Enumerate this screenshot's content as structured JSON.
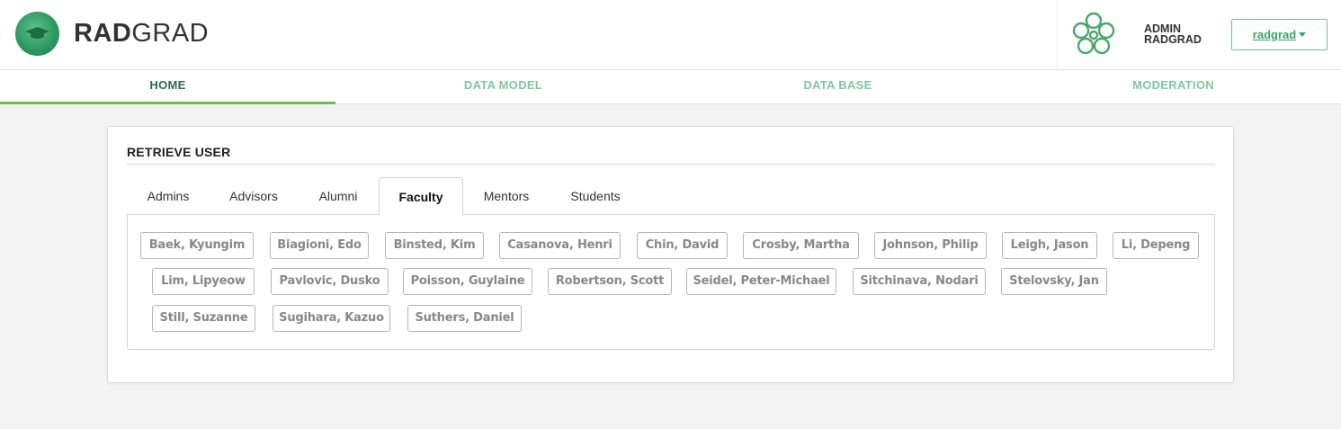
{
  "header": {
    "brand_bold": "RAD",
    "brand_light": "GRAD",
    "admin_line1": "ADMIN",
    "admin_line2": "RADGRAD",
    "user_button": "radgrad",
    "icons": [
      "graduation-cap-logo",
      "radgrad-flower-icon",
      "caret-down-icon"
    ]
  },
  "nav": {
    "items": [
      "HOME",
      "DATA MODEL",
      "DATA BASE",
      "MODERATION"
    ],
    "active": "HOME"
  },
  "card": {
    "title": "RETRIEVE USER",
    "tabs": [
      "Admins",
      "Advisors",
      "Alumni",
      "Faculty",
      "Mentors",
      "Students"
    ],
    "active_tab": "Faculty",
    "users": [
      "Baek, Kyungim",
      "Biagioni, Edo",
      "Binsted, Kim",
      "Casanova, Henri",
      "Chin, David",
      "Crosby, Martha",
      "Johnson, Philip",
      "Leigh, Jason",
      "Li, Depeng",
      "Lim, Lipyeow",
      "Pavlovic, Dusko",
      "Poisson, Guylaine",
      "Robertson, Scott",
      "Seidel, Peter-Michael",
      "Sitchinava, Nodari",
      "Stelovsky, Jan",
      "Still, Suzanne",
      "Sugihara, Kazuo",
      "Suthers, Daniel"
    ]
  },
  "colors": {
    "accent_green": "#3aa363",
    "nav_inactive": "#7cc99c",
    "nav_active": "#2f6b4a",
    "nav_underline": "#6cbf4d"
  }
}
